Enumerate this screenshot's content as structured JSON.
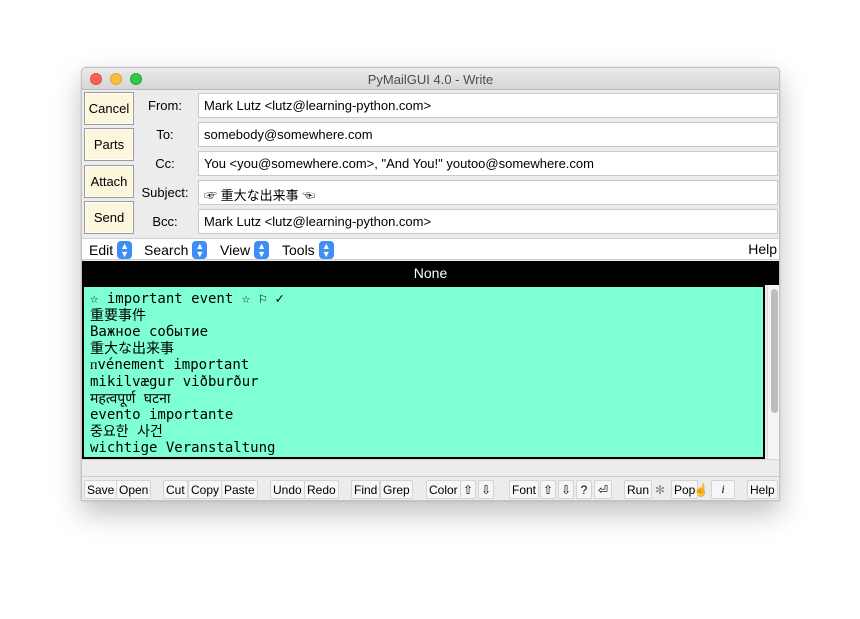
{
  "window": {
    "title": "PyMailGUI 4.0 - Write"
  },
  "side_buttons": [
    "Cancel",
    "Parts",
    "Attach",
    "Send"
  ],
  "headers": [
    {
      "label": "From:",
      "value": "Mark Lutz <lutz@learning-python.com>"
    },
    {
      "label": "To:",
      "value": "somebody@somewhere.com"
    },
    {
      "label": "Cc:",
      "value": "You <you@somewhere.com>, \"And You!\" youtoo@somewhere.com"
    },
    {
      "label": "Subject:",
      "value": "☞ 重大な出来事 ☜"
    },
    {
      "label": "Bcc:",
      "value": "Mark Lutz <lutz@learning-python.com>"
    }
  ],
  "menus": [
    "Edit",
    "Search",
    "View",
    "Tools"
  ],
  "help_label": "Help",
  "text_label": "None",
  "body_lines": [
    "☆ important event ☆ ⚐ ✓",
    "重要事件",
    "Важное событие",
    "重大な出来事",
    "ᴨvénement important",
    "mikilvægur viðburður",
    "महत्वपूर्ण घटना",
    "evento importante",
    "중요한 사건",
    "wichtige Veranstaltung"
  ],
  "toolbar": {
    "save": "Save",
    "open": "Open",
    "cut": "Cut",
    "copy": "Copy",
    "paste": "Paste",
    "undo": "Undo",
    "redo": "Redo",
    "find": "Find",
    "grep": "Grep",
    "color": "Color",
    "color_up": "⇧",
    "color_down": "⇩",
    "font": "Font",
    "font_up": "⇧",
    "font_down": "⇩",
    "font_q": "?",
    "font_enter": "⏎",
    "run": "Run",
    "run_icon": "✻",
    "pop": "Pop",
    "pop_icon": "☝",
    "info": "i",
    "help": "Help"
  }
}
